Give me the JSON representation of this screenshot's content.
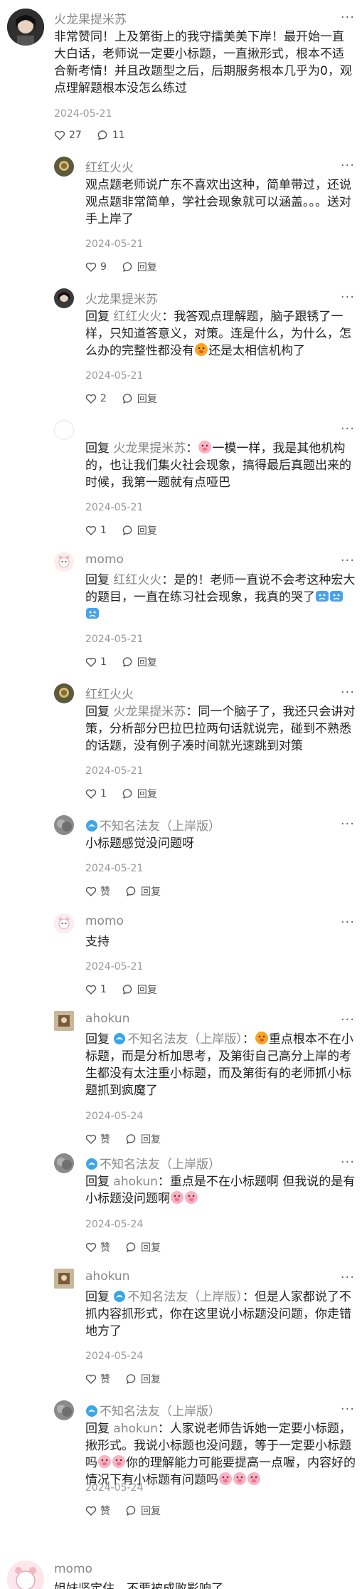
{
  "comments": [
    {
      "name": "火龙果提米苏",
      "body": "非常赞同！上及第街上的我守擂美美下岸！最开始一直大白话，老师说一定要小标题，一直揪形式，根本不适合新考情！并且改题型之后，后期服务根本几乎为0，观点理解题根本没怎么练过",
      "date": "2024-05-21",
      "likes": "27",
      "replies": "11"
    },
    {
      "name": "红红火火",
      "body": "观点题老师说广东不喜欢出这种，简单带过，还说观点题非常简单，学社会现象就可以涵盖。。。送对手上岸了",
      "date": "2024-05-21",
      "likes": "9",
      "reply_label": "回复"
    },
    {
      "name": "火龙果提米苏",
      "reply_prefix": "回复",
      "mention": "红红火火",
      "body_a": "：我答观点理解题，脑子跟锈了一样，只知道答意义，对策。连是什么，为什么，怎么办的完整性都没有",
      "body_b": "还是太相信机构了",
      "date": "2024-05-21",
      "likes": "2",
      "reply_label": "回复"
    },
    {
      "reply_prefix": "回复",
      "mention": "火龙果提米苏",
      "body_b": "一模一样，我是其他机构的，也让我们集火社会现象，搞得最后真题出来的时候，我第一题就有点哑巴",
      "date": "2024-05-21",
      "likes": "1",
      "reply_label": "回复"
    },
    {
      "name": "momo",
      "reply_prefix": "回复",
      "mention": "红红火火",
      "body_a": "：是的！老师一直说不会考这种宏大的题目，一直在练习社会现象，我真的哭了",
      "date": "2024-05-21",
      "likes": "1",
      "reply_label": "回复"
    },
    {
      "name": "红红火火",
      "reply_prefix": "回复",
      "mention": "火龙果提米苏",
      "body_a": "：同一个脑子了，我还只会讲对策，分析部分巴拉巴拉两句话就说完，碰到不熟悉的话题，没有例子凑时间就光速跳到对策",
      "date": "2024-05-21",
      "likes": "1",
      "reply_label": "回复"
    },
    {
      "name": "不知名法友（上岸版）",
      "body": "小标题感觉没问题呀",
      "date": "2024-05-21",
      "likes": "赞",
      "reply_label": "回复"
    },
    {
      "name": "momo",
      "body": "支持",
      "date": "2024-05-21",
      "likes": "1",
      "reply_label": "回复"
    },
    {
      "name": "ahokun",
      "reply_prefix": "回复",
      "mention": "不知名法友（上岸版）",
      "body_a": "：",
      "body_b": "重点根本不在小标题，而是分析加思考，及第街自己高分上岸的考生都没有太注重小标题，而及第街有的老师抓小标题抓到疯魔了",
      "date": "2024-05-24",
      "likes": "赞",
      "reply_label": "回复"
    },
    {
      "name": "不知名法友（上岸版）",
      "reply_prefix": "回复",
      "mention": "ahokun",
      "body_a": "：重点是不在小标题啊 但我说的是有小标题没问题啊",
      "date": "2024-05-24",
      "likes": "赞",
      "reply_label": "回复"
    },
    {
      "name": "ahokun",
      "reply_prefix": "回复",
      "mention": "不知名法友（上岸版）",
      "body_a": "：但是人家都说了不抓内容抓形式，你在这里说小标题没问题，你走错地方了",
      "date": "2024-05-24",
      "likes": "赞",
      "reply_label": "回复"
    },
    {
      "name": "不知名法友（上岸版）",
      "reply_prefix": "回复",
      "mention": "ahokun",
      "body_a": "：人家说老师告诉她一定要小标题，揪形式。我说小标题也没问题，等于一定要小标题吗",
      "body_b": "你的理解能力可能要提高一点喔，内容好的情况下有小标题有问题吗",
      "date": "2024-05-24",
      "likes": "赞",
      "reply_label": "回复"
    },
    {
      "name": "momo",
      "body": "姐妹坚定住，不要被成败影响了"
    }
  ],
  "icons": {
    "heart": "heart-icon",
    "chat": "chat-bubble-icon",
    "more": "more-dots-icon",
    "badge": "wave-badge-icon",
    "pig": "pig-emoji-icon",
    "cry": "crying-emoji-icon"
  },
  "more_glyph": "···",
  "colors": {
    "text": "#222222",
    "meta": "#888888",
    "date": "#999999",
    "badge": "#3aa6e8"
  }
}
